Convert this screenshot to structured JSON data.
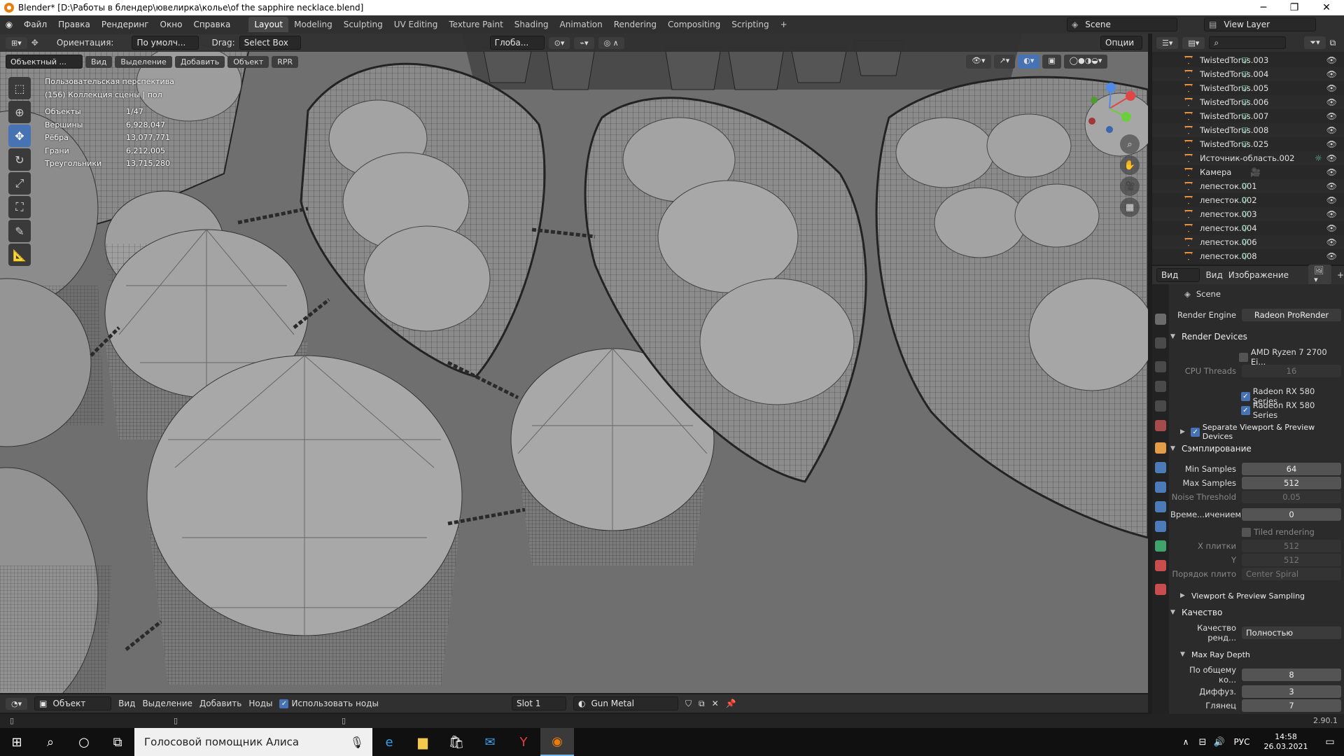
{
  "window": {
    "title": "Blender* [D:\\Работы в блендер\\ювелирка\\колье\\of the sapphire necklace.blend]",
    "minimize": "─",
    "maximize": "❐",
    "close": "✕"
  },
  "topbar": {
    "menus": [
      "Файл",
      "Правка",
      "Рендеринг",
      "Окно",
      "Справка"
    ],
    "workspaces": [
      "Layout",
      "Modeling",
      "Sculpting",
      "UV Editing",
      "Texture Paint",
      "Shading",
      "Animation",
      "Rendering",
      "Compositing",
      "Scripting"
    ],
    "active_workspace": "Layout",
    "add_workspace": "+",
    "scene": "Scene",
    "view_layer": "View Layer"
  },
  "viewport": {
    "orientation_label": "Ориентация:",
    "orientation_value": "По умолч...",
    "drag_label": "Drag:",
    "drag_value": "Select Box",
    "transform_space": "Глоба...",
    "options": "Опции",
    "mode": "Объектный ...",
    "header_menus": [
      "Вид",
      "Выделение",
      "Добавить",
      "Объект",
      "RPR"
    ],
    "view_name": "Пользовательская перспектива",
    "collection": "(156) Коллекция сцены | пол",
    "stats": [
      {
        "label": "Объекты",
        "value": "1/47"
      },
      {
        "label": "Вершины",
        "value": "6,928,047"
      },
      {
        "label": "Рёбра",
        "value": "13,077,771"
      },
      {
        "label": "Грани",
        "value": "6,212,005"
      },
      {
        "label": "Треугольники",
        "value": "13,715,280"
      }
    ]
  },
  "outliner": {
    "search_placeholder": "",
    "items": [
      {
        "name": "TwistedTorus.003",
        "type": "mesh"
      },
      {
        "name": "TwistedTorus.004",
        "type": "mesh"
      },
      {
        "name": "TwistedTorus.005",
        "type": "mesh"
      },
      {
        "name": "TwistedTorus.006",
        "type": "mesh"
      },
      {
        "name": "TwistedTorus.007",
        "type": "mesh"
      },
      {
        "name": "TwistedTorus.008",
        "type": "mesh"
      },
      {
        "name": "TwistedTorus.025",
        "type": "mesh"
      },
      {
        "name": "Источник-область.002",
        "type": "light"
      },
      {
        "name": "Камера",
        "type": "camera"
      },
      {
        "name": "лепесток.001",
        "type": "mesh"
      },
      {
        "name": "лепесток.002",
        "type": "mesh"
      },
      {
        "name": "лепесток.003",
        "type": "mesh"
      },
      {
        "name": "лепесток.004",
        "type": "mesh"
      },
      {
        "name": "лепесток.006",
        "type": "mesh"
      },
      {
        "name": "лепесток.008",
        "type": "mesh"
      }
    ]
  },
  "image_editor": {
    "view": "Вид",
    "menus": [
      "Вид",
      "Изображение"
    ]
  },
  "properties": {
    "scene": "Scene",
    "render_engine_label": "Render Engine",
    "render_engine_value": "Radeon ProRender",
    "render_devices": "Render Devices",
    "cpu_device": "AMD Ryzen 7 2700 Ei...",
    "cpu_threads_label": "CPU Threads",
    "cpu_threads_value": "16",
    "gpu1": "Radeon RX 580 Series",
    "gpu2": "Radeon RX 580 Series",
    "separate_devices": "Separate Viewport & Preview Devices",
    "sampling": "Сэмплирование",
    "min_samples_label": "Min Samples",
    "min_samples_value": "64",
    "max_samples_label": "Max Samples",
    "max_samples_value": "512",
    "noise_threshold_label": "Noise Threshold",
    "noise_threshold_value": "0.05",
    "time_limit_label": "Време...ичением",
    "time_limit_value": "0",
    "tiled_rendering": "Tiled rendering",
    "tile_x_label": "X плитки",
    "tile_x_value": "512",
    "tile_y_label": "Y",
    "tile_y_value": "512",
    "tile_order_label": "Порядок плито",
    "tile_order_value": "Center Spiral",
    "viewport_sampling": "Viewport & Preview Sampling",
    "quality": "Качество",
    "render_quality_label": "Качество ренд...",
    "render_quality_value": "Полностью",
    "max_ray_depth": "Max Ray Depth",
    "total_label": "По общему ко...",
    "total_value": "8",
    "diffuse_label": "Диффуз.",
    "diffuse_value": "3",
    "glossy_label": "Глянец",
    "glossy_value": "7"
  },
  "node_editor": {
    "mode": "Объект",
    "menus": [
      "Вид",
      "Выделение",
      "Добавить",
      "Ноды"
    ],
    "use_nodes": "Использовать ноды",
    "slot": "Slot 1",
    "material": "Gun Metal"
  },
  "statusbar": {
    "version": "2.90.1"
  },
  "taskbar": {
    "search_text": "Голосовой помощник Алиса",
    "language": "РУС",
    "time": "14:58",
    "date": "26.03.2021"
  },
  "colors": {
    "accent": "#4772b3",
    "blender_orange": "#e87d0d",
    "mesh_green": "#62d0a0"
  }
}
